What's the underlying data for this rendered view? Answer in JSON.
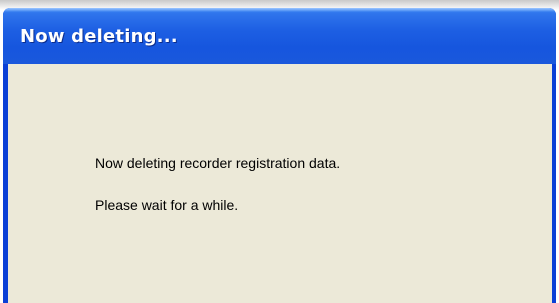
{
  "window": {
    "title": "Now deleting...",
    "messages": [
      "Now deleting recorder registration data.",
      "Please wait for a while."
    ]
  },
  "colors": {
    "titlebar": "#1d5fe3",
    "frame": "#0a3fd6",
    "client_background": "#ece9d8",
    "title_text": "#ffffff",
    "message_text": "#000000"
  }
}
